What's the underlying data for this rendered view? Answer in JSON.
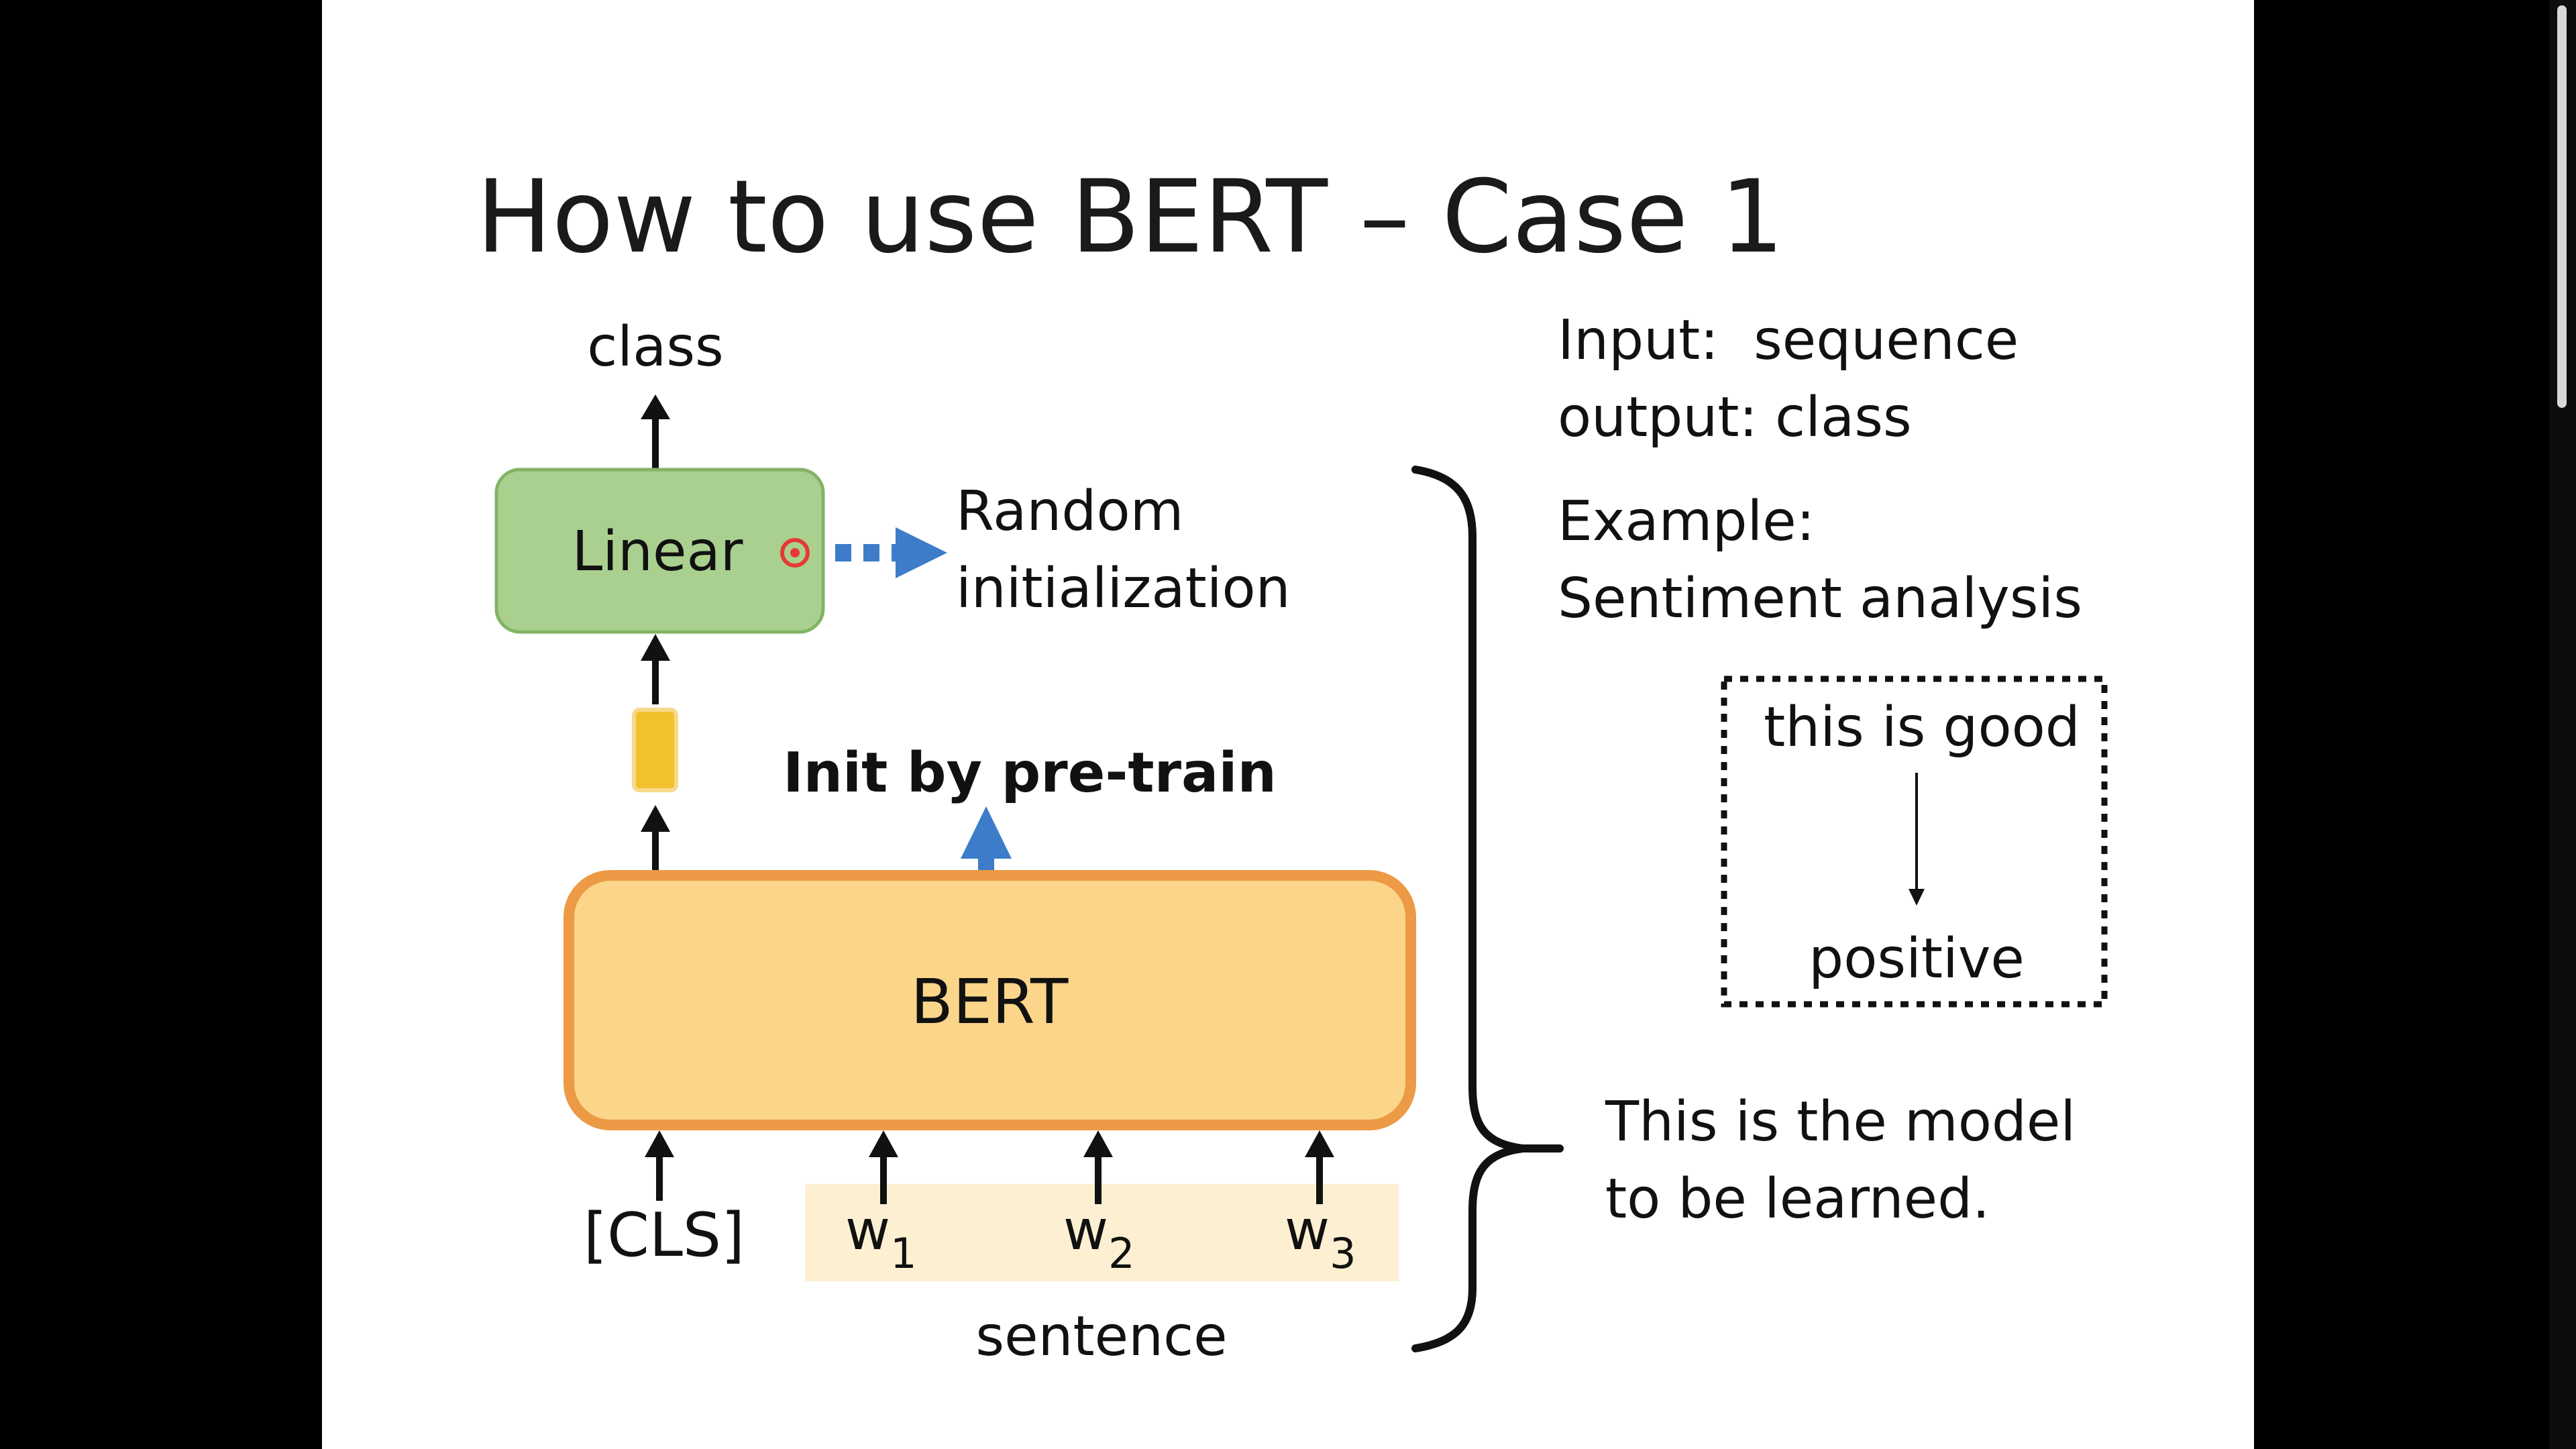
{
  "slide": {
    "title": "How to use BERT – Case 1"
  },
  "diagram": {
    "output_label": "class",
    "linear_label": "Linear",
    "random_init_line1": "Random",
    "random_init_line2": "initialization",
    "init_pretrain_label": "Init by pre-train",
    "bert_label": "BERT",
    "cls_token": "[CLS]",
    "tokens": [
      {
        "letter": "w",
        "sub": "1"
      },
      {
        "letter": "w",
        "sub": "2"
      },
      {
        "letter": "w",
        "sub": "3"
      }
    ],
    "sentence_label": "sentence",
    "brace_note_line1": "This is the model",
    "brace_note_line2": "to be learned."
  },
  "info": {
    "input_line": "Input:  sequence",
    "output_line": "output: class",
    "example_label": "Example:",
    "example_task": "Sentiment analysis",
    "example_input": "this is good",
    "example_output": "positive"
  },
  "colors": {
    "linear_fill": "#a9d08e",
    "linear_border": "#82b366",
    "bert_fill": "#fbd58a",
    "bert_border": "#ec9a45",
    "cls_vector": "#f2c12e",
    "dotted_arrow": "#3d7cc9",
    "sentence_band": "#fdf0d2",
    "laser_pointer": "#e53935"
  }
}
